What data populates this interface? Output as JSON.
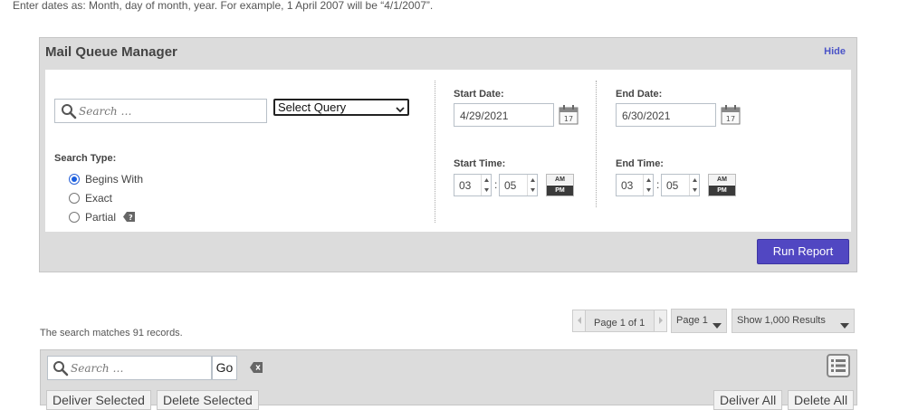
{
  "hint": "Enter dates as: Month, day of month, year. For example, 1 April 2007 will be “4/1/2007”.",
  "panel": {
    "title": "Mail Queue Manager",
    "hide_label": "Hide",
    "search_placeholder": "Search …",
    "select_query": "Select Query",
    "search_type_label": "Search Type:",
    "search_types": [
      "Begins With",
      "Exact",
      "Partial"
    ],
    "selected_search_type": "Begins With",
    "start_date_label": "Start Date:",
    "start_date": "4/29/2021",
    "end_date_label": "End Date:",
    "end_date": "6/30/2021",
    "start_time_label": "Start Time:",
    "start_hour": "03",
    "start_minute": "05",
    "end_time_label": "End Time:",
    "end_hour": "03",
    "end_minute": "05",
    "time_sep": ":",
    "am_label": "AM",
    "pm_label": "PM",
    "selected_period": "PM",
    "calendar_day": "17",
    "run_report": "Run Report"
  },
  "results": {
    "matches": "The search matches 91 records.",
    "page_text": "Page 1 of 1",
    "page_select": "Page 1",
    "show_select": "Show 1,000 Results"
  },
  "grid": {
    "search_placeholder": "Search …",
    "go_label": "Go",
    "deliver_selected": "Deliver Selected",
    "delete_selected": "Delete Selected",
    "deliver_all": "Deliver All",
    "delete_all": "Delete All"
  },
  "colors": {
    "accent": "#5147c2",
    "link": "#4a53c7",
    "panel_bg": "#dcdcdc"
  }
}
